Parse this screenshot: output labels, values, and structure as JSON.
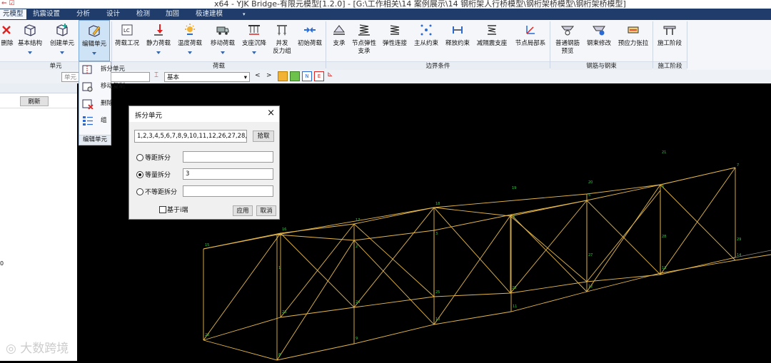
{
  "window_title": "x64 - YJK Bridge-有限元模型[1.2.0] - [G:\\工作相关\\14 案例展示\\14 钢桁架人行桥模型\\钢桁架桥模型\\钢桁架桥模型]",
  "tabs": [
    "元模型",
    "抗震设置",
    "分析",
    "设计",
    "检测",
    "加固",
    "极速建模"
  ],
  "ribbon": {
    "unit": [
      "删除",
      "基本结构",
      "创建单元",
      "编辑单元"
    ],
    "load": [
      "荷载工况",
      "静力荷载",
      "温度荷载",
      "移动荷载",
      "支座沉降",
      "并发\n反力组",
      "初始荷载"
    ],
    "boundary": [
      "支承",
      "节点弹性\n支承",
      "弹性连接",
      "主从约束",
      "释放约束",
      "减隔震支座",
      "节点局部系"
    ],
    "rebar": [
      "普通钢筋\n预览",
      "钢束修改",
      "预应力张拉"
    ],
    "stage": [
      "施工阶段"
    ],
    "groups": {
      "unit": "单元",
      "load": "荷载",
      "boundary": "边界条件",
      "rebar": "钢筋与钢束",
      "stage": "施工阶段"
    }
  },
  "toolbar2": {
    "input_prefix": "单元",
    "combo": "基本",
    "nav_prev": "<",
    "nav_next": ">"
  },
  "left_panel": {
    "refresh": "刷新",
    "number": "0"
  },
  "dropdown": {
    "items": [
      "拆分单元",
      "移动复制",
      "删除",
      "组"
    ],
    "footer": "编辑单元"
  },
  "dialog": {
    "title": "拆分单元",
    "elements": "1,2,3,4,5,6,7,8,9,10,11,12,26,27,28,29,",
    "pick": "拾取",
    "opt1": "等距拆分",
    "opt2": "等量拆分",
    "opt3": "不等距拆分",
    "val2": "3",
    "base_label": "基于i端",
    "apply": "应用",
    "cancel": "取消",
    "selected_option": 2
  },
  "watermark": "大数跨境",
  "node_labels": [
    "1",
    "2",
    "3",
    "4",
    "5",
    "6",
    "7",
    "8",
    "9",
    "10",
    "11",
    "12",
    "13",
    "14",
    "15",
    "16",
    "17",
    "18",
    "19",
    "20",
    "21",
    "22",
    "23",
    "24",
    "25",
    "26",
    "27",
    "28",
    "29"
  ],
  "colors": {
    "truss": "#e6b84a",
    "node_label": "#2ecc40",
    "element_label": "#ff3c3c",
    "ribbon_tab": "#1f3c6a"
  }
}
